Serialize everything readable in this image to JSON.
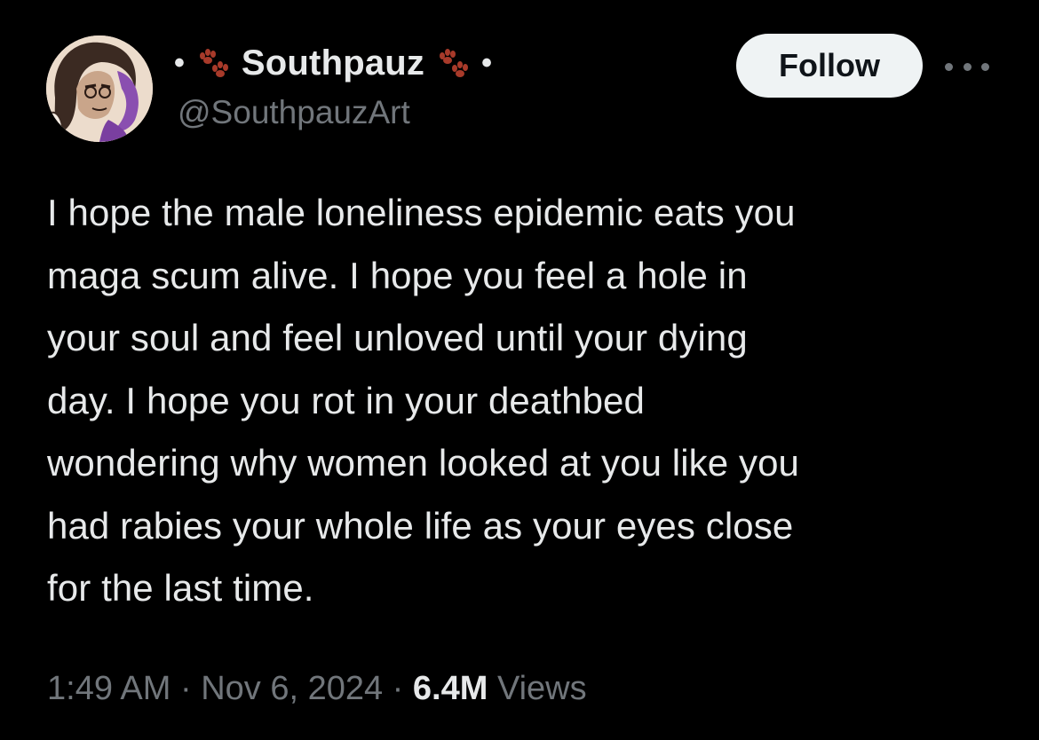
{
  "author": {
    "display_name": "Southpauz",
    "handle": "@SouthpauzArt",
    "name_decoration_dot": "•",
    "paw_icon": "paw-prints-icon",
    "avatar_icon": "avatar-illustration"
  },
  "follow_button": {
    "label": "Follow"
  },
  "more_button": {
    "icon": "more-horizontal-icon"
  },
  "tweet": {
    "lines": [
      "I hope the male loneliness epidemic eats you",
      "maga scum alive. I hope you feel a hole in",
      "your soul and feel unloved until your dying",
      "day. I hope you rot in your deathbed",
      "wondering why women looked at you like you",
      "had rabies your whole life as your eyes close",
      "for the last time."
    ]
  },
  "meta": {
    "time": "1:49 AM",
    "separator": " · ",
    "date": "Nov 6, 2024",
    "views_count": "6.4M",
    "views_label": " Views"
  },
  "colors": {
    "background": "#000000",
    "text_primary": "#e7e9ea",
    "text_secondary": "#71767b",
    "follow_bg": "#eff3f4",
    "paw": "#a83a2a"
  }
}
